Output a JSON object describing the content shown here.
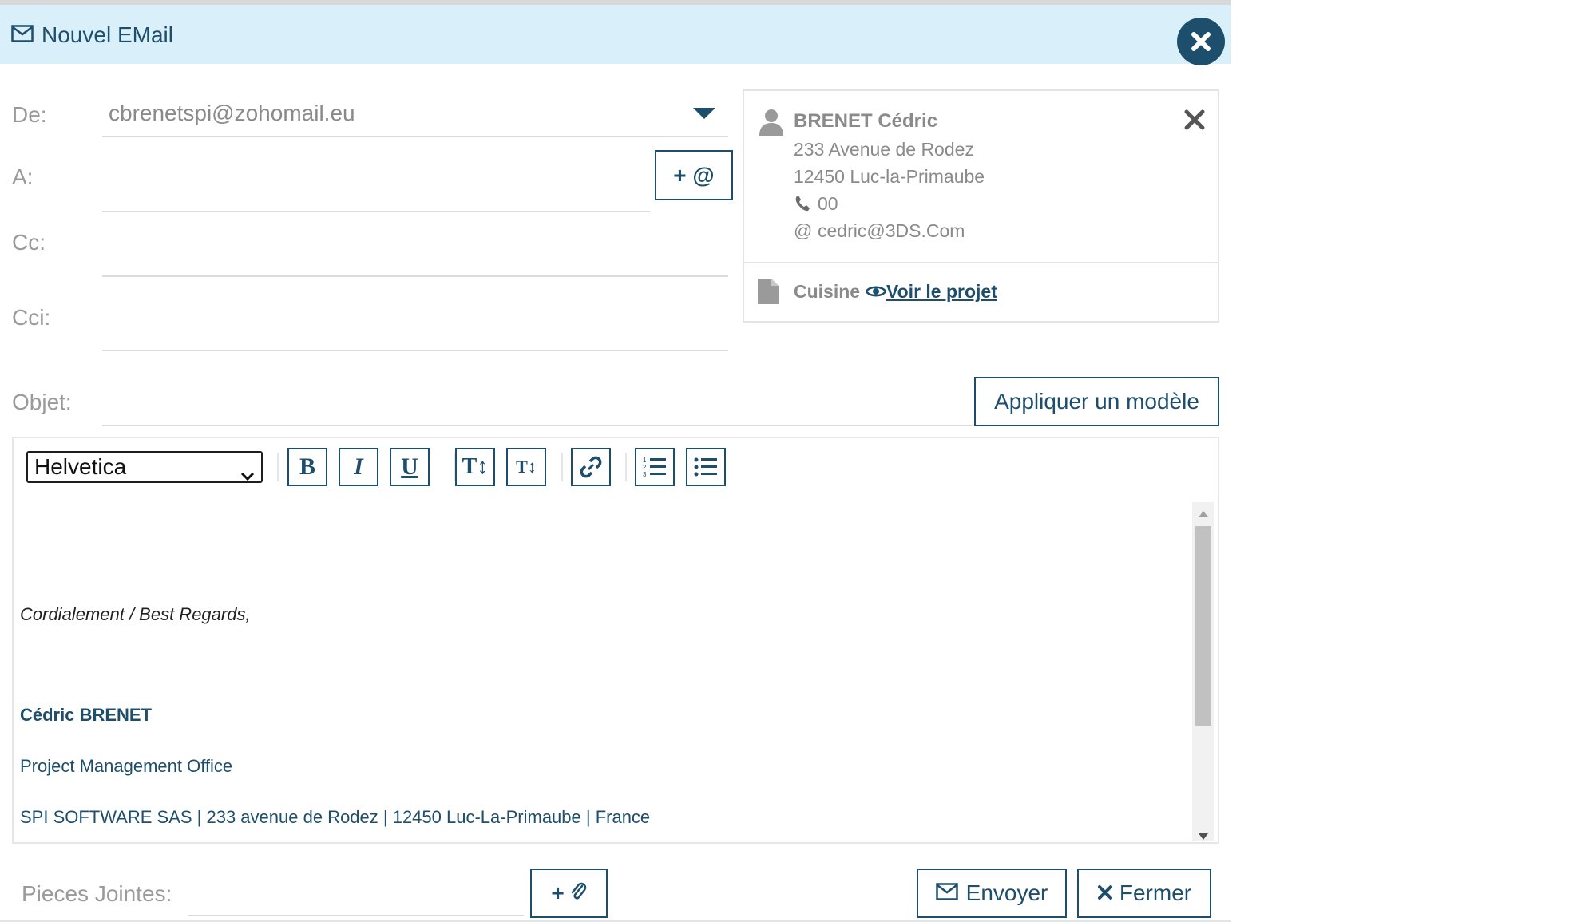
{
  "dialog": {
    "title": "Nouvel EMail",
    "title_icon": "envelope-icon",
    "close_icon": "close-circle-icon"
  },
  "form": {
    "from_label": "De:",
    "from_value": "cbrenetspi@zohomail.eu",
    "to_label": "A:",
    "to_value": "",
    "add_address_label": "+ @",
    "cc_label": "Cc:",
    "cc_value": "",
    "bcc_label": "Cci:",
    "bcc_value": "",
    "subject_label": "Objet:",
    "subject_value": "",
    "apply_template_label": "Appliquer un modèle"
  },
  "contact": {
    "name": "BRENET Cédric",
    "address1": "233 Avenue de Rodez",
    "address2": "12450 Luc-la-Primaube",
    "phone": "00",
    "email": "cedric@3DS.Com",
    "project_name": "Cuisine",
    "project_link": "Voir le projet"
  },
  "editor": {
    "font": "Helvetica",
    "toolbar": [
      "bold",
      "italic",
      "underline",
      "text-size-increase",
      "text-size-decrease",
      "link",
      "ordered-list",
      "bullet-list"
    ],
    "body": {
      "greeting": "Cordialement / Best Regards,",
      "sig_name": "Cédric BRENET",
      "sig_role": "Project Management Office",
      "sig_company": "SPI SOFTWARE SAS | 233 avenue de Rodez | 12450 Luc-La-Primaube | France"
    }
  },
  "footer": {
    "attachments_label": "Pieces Jointes:",
    "add_attachment_label": "+",
    "send_label": "Envoyer",
    "close_label": "Fermer"
  },
  "colors": {
    "accent": "#1d4e6b",
    "titlebar": "#d9effa"
  }
}
